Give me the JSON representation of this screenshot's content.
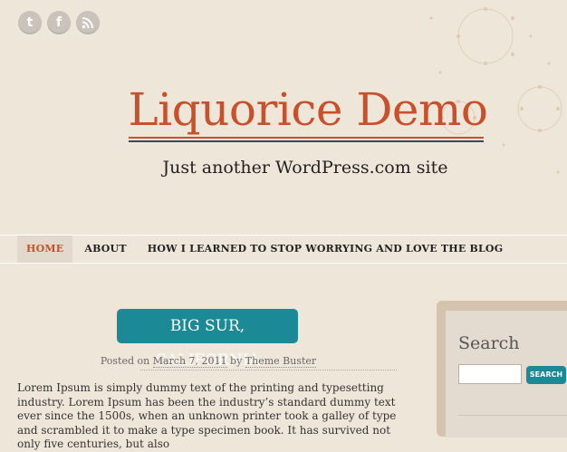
{
  "social": {
    "twitter_icon": "twitter-icon",
    "facebook_icon": "facebook-icon",
    "rss_icon": "rss-icon"
  },
  "site": {
    "title": "Liquorice Demo",
    "tagline": "Just another WordPress.com site"
  },
  "nav": {
    "items": [
      "HOME",
      "ABOUT",
      "HOW I LEARNED TO STOP WORRYING AND LOVE THE BLOG"
    ]
  },
  "post": {
    "title": "BIG SUR, CALIFORNIA",
    "posted_on": "Posted on",
    "date": "March 7, 2011",
    "by": "by",
    "author": "Theme Buster",
    "body": "Lorem Ipsum is simply dummy text of the printing and typesetting industry. Lorem Ipsum has been the industry’s standard dummy text ever since the 1500s, when an unknown printer took a galley of type and scrambled it to make a type specimen book. It has survived not only five centuries, but also"
  },
  "sidebar": {
    "search_title": "Search",
    "search_button": "SEARCH",
    "search_value": ""
  },
  "colors": {
    "accent": "#c8502a",
    "teal": "#1b8a96",
    "background": "#efe6da"
  }
}
